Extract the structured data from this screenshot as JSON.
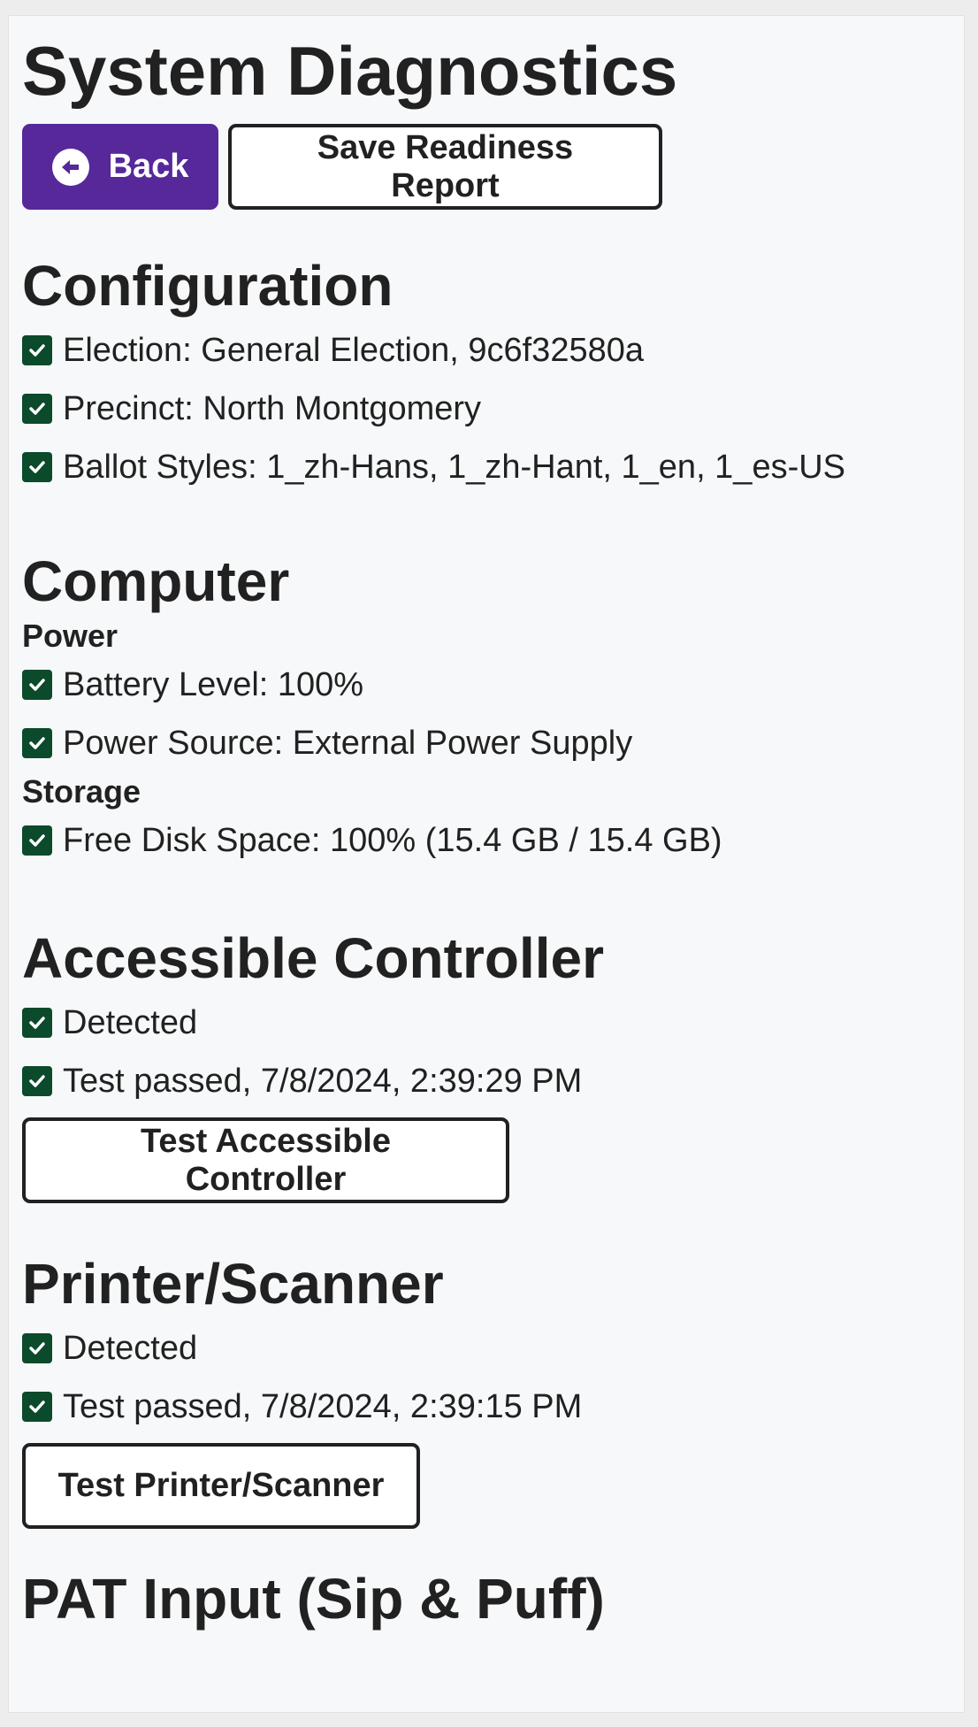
{
  "page": {
    "title": "System Diagnostics"
  },
  "toolbar": {
    "back_label": "Back",
    "save_report_label": "Save Readiness Report"
  },
  "configuration": {
    "title": "Configuration",
    "items": [
      "Election: General Election, 9c6f32580a",
      "Precinct: North Montgomery",
      "Ballot Styles: 1_zh-Hans, 1_zh-Hant, 1_en, 1_es-US"
    ]
  },
  "computer": {
    "title": "Computer",
    "power": {
      "title": "Power",
      "items": [
        "Battery Level: 100%",
        "Power Source: External Power Supply"
      ]
    },
    "storage": {
      "title": "Storage",
      "items": [
        "Free Disk Space: 100% (15.4 GB / 15.4 GB)"
      ]
    }
  },
  "accessible_controller": {
    "title": "Accessible Controller",
    "items": [
      "Detected",
      "Test passed, 7/8/2024, 2:39:29 PM"
    ],
    "test_button_label": "Test Accessible Controller"
  },
  "printer_scanner": {
    "title": "Printer/Scanner",
    "items": [
      "Detected",
      "Test passed, 7/8/2024, 2:39:15 PM"
    ],
    "test_button_label": "Test Printer/Scanner"
  },
  "pat_input": {
    "title": "PAT Input (Sip & Puff)"
  },
  "colors": {
    "primary": "#56289a",
    "success": "#0b4a2b",
    "text": "#212121",
    "background": "#f7f8f9"
  },
  "icons": {
    "back": "circle-arrow-left-icon",
    "status": "checkbox-check-icon"
  }
}
